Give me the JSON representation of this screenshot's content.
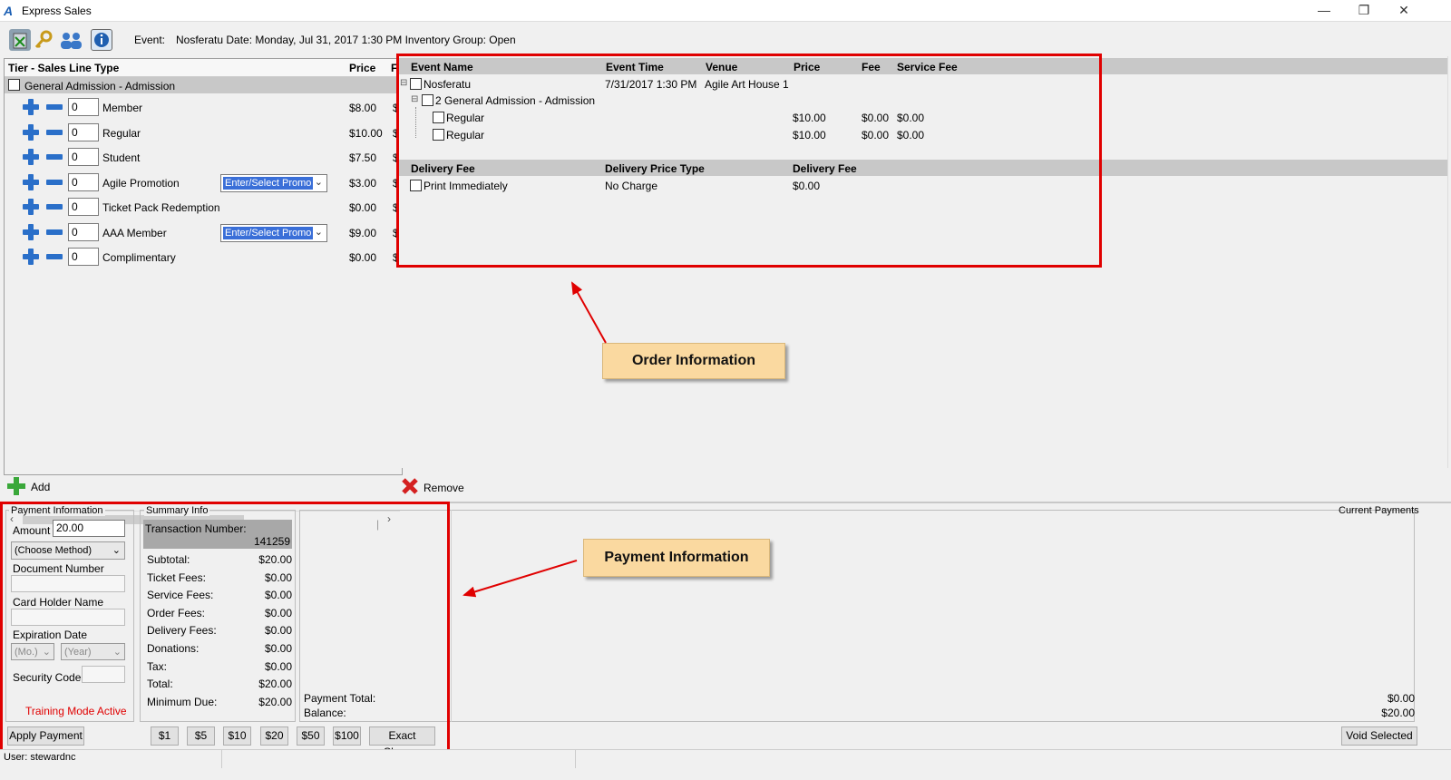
{
  "window": {
    "title": "Express Sales",
    "minimize": "—",
    "restore": "❐",
    "close": "✕"
  },
  "toolbar": {
    "icons": [
      "delete-cart-icon",
      "key-icon",
      "users-icon",
      "info-icon"
    ],
    "event_label": "Event:",
    "event_value": "Nosferatu Date: Monday, Jul 31, 2017 1:30 PM Inventory Group: Open"
  },
  "tiers": {
    "col_tier": "Tier - Sales Line Type",
    "col_price": "Price",
    "col_extra": "F",
    "group": "General Admission - Admission",
    "rows": [
      {
        "qty": "0",
        "label": "Member",
        "price": "$8.00",
        "promo": ""
      },
      {
        "qty": "0",
        "label": "Regular",
        "price": "$10.00",
        "promo": ""
      },
      {
        "qty": "0",
        "label": "Student",
        "price": "$7.50",
        "promo": ""
      },
      {
        "qty": "0",
        "label": "Agile Promotion",
        "price": "$3.00",
        "promo": "Enter/Select Promo"
      },
      {
        "qty": "0",
        "label": "Ticket Pack Redemption",
        "price": "$0.00",
        "promo": ""
      },
      {
        "qty": "0",
        "label": "AAA Member",
        "price": "$9.00",
        "promo": "Enter/Select Promo"
      },
      {
        "qty": "0",
        "label": "Complimentary",
        "price": "$0.00",
        "promo": ""
      }
    ],
    "trail": "$"
  },
  "order": {
    "headers": {
      "event_name": "Event Name",
      "event_time": "Event Time",
      "venue": "Venue",
      "price": "Price",
      "fee": "Fee",
      "service_fee": "Service Fee"
    },
    "event": {
      "name": "Nosferatu",
      "time": "7/31/2017 1:30 PM",
      "venue": "Agile Art House 1"
    },
    "group": "2 General Admission - Admission",
    "lines": [
      {
        "label": "Regular",
        "price": "$10.00",
        "fee": "$0.00",
        "service_fee": "$0.00"
      },
      {
        "label": "Regular",
        "price": "$10.00",
        "fee": "$0.00",
        "service_fee": "$0.00"
      }
    ],
    "delivery_headers": {
      "fee": "Delivery Fee",
      "price_type": "Delivery Price Type",
      "fee2": "Delivery Fee"
    },
    "delivery": {
      "label": "Print Immediately",
      "price_type": "No Charge",
      "fee": "$0.00"
    }
  },
  "callouts": {
    "order": "Order Information",
    "payment": "Payment Information"
  },
  "actions": {
    "add": "Add",
    "remove": "Remove"
  },
  "payment": {
    "group_label": "Payment Information",
    "amount_label": "Amount",
    "amount_value": "20.00",
    "method": "(Choose Method)",
    "document_number": "Document Number",
    "card_holder": "Card Holder Name",
    "expiration": "Expiration Date",
    "month": "(Mo.)",
    "year": "(Year)",
    "security_code": "Security Code",
    "training": "Training Mode Active",
    "apply": "Apply Payment"
  },
  "summary": {
    "group_label": "Summary Info",
    "transaction_label": "Transaction Number:",
    "transaction_number": "141259",
    "rows": [
      {
        "label": "Subtotal:",
        "value": "$20.00"
      },
      {
        "label": "Ticket Fees:",
        "value": "$0.00"
      },
      {
        "label": "Service Fees:",
        "value": "$0.00"
      },
      {
        "label": "Order Fees:",
        "value": "$0.00"
      },
      {
        "label": "Delivery Fees:",
        "value": "$0.00"
      },
      {
        "label": "Donations:",
        "value": "$0.00"
      },
      {
        "label": "Tax:",
        "value": "$0.00"
      },
      {
        "label": "Total:",
        "value": "$20.00"
      },
      {
        "label": "Minimum Due:",
        "value": "$20.00"
      }
    ]
  },
  "cash_buttons": [
    "$1",
    "$5",
    "$10",
    "$20",
    "$50",
    "$100",
    "Exact Change"
  ],
  "current_payments": {
    "label": "Current Payments",
    "payment_total_label": "Payment Total:",
    "payment_total": "$0.00",
    "balance_label": "Balance:",
    "balance": "$20.00",
    "void": "Void Selected"
  },
  "status": {
    "user": "User: stewardnc"
  },
  "colors": {
    "accent_blue": "#2a6fc9",
    "red_box": "#e00000",
    "callout": "#fad9a0",
    "training_red": "#e00000"
  }
}
